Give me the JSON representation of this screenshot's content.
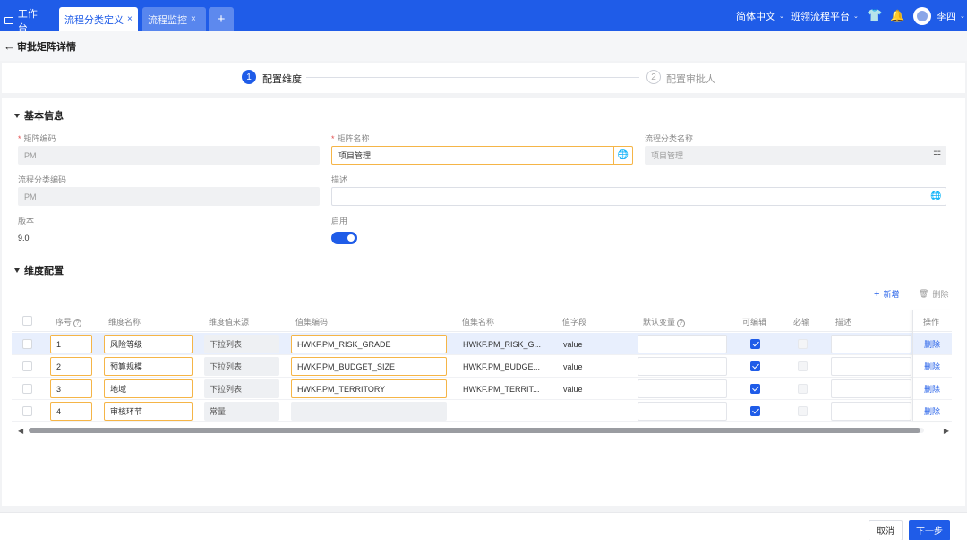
{
  "topbar": {
    "tabs": [
      {
        "label": "工作台"
      },
      {
        "label": "流程分类定义",
        "close": "×"
      },
      {
        "label": "流程监控",
        "close": "×"
      },
      {
        "label": "+"
      }
    ],
    "language": "简体中文",
    "platform": "班翎流程平台",
    "user": "李四",
    "chevron": "⌄",
    "shirt_glyph": "👕",
    "bell_glyph": "🔔",
    "accent_color": "#1f5ce8"
  },
  "header": {
    "back_arrow": "←",
    "title": "审批矩阵详情"
  },
  "steps": [
    {
      "num": "1",
      "label": "配置维度"
    },
    {
      "num": "2",
      "label": "配置审批人"
    }
  ],
  "basic": {
    "title": "基本信息",
    "matrix_code": {
      "label": "矩阵编码",
      "value": "PM"
    },
    "matrix_name": {
      "label": "矩阵名称",
      "value": "项目管理"
    },
    "category_name": {
      "label": "流程分类名称",
      "value": "项目管理"
    },
    "category_code": {
      "label": "流程分类编码",
      "value": "PM"
    },
    "description": {
      "label": "描述",
      "value": ""
    },
    "version": {
      "label": "版本",
      "value": "9.0"
    },
    "enabled": {
      "label": "启用",
      "value": true
    },
    "required_mark": "*",
    "globe_icon": "🌐",
    "lookup_icon": "☷"
  },
  "dimension": {
    "title": "维度配置",
    "add_label": "新增",
    "delete_label": "删除",
    "add_glyph": "+",
    "trash_glyph": "🗑",
    "help_glyph": "?",
    "columns": [
      "序号",
      "维度名称",
      "维度值来源",
      "值集编码",
      "值集名称",
      "值字段",
      "默认变量",
      "可编辑",
      "必输",
      "描述",
      "操作"
    ],
    "rows": [
      {
        "seq": "1",
        "name": "风险等级",
        "source": "下拉列表",
        "code": "HWKF.PM_RISK_GRADE",
        "set_name": "HWKF.PM_RISK_G...",
        "field": "value",
        "editable": true,
        "required": false,
        "op": "删除"
      },
      {
        "seq": "2",
        "name": "预算规模",
        "source": "下拉列表",
        "code": "HWKF.PM_BUDGET_SIZE",
        "set_name": "HWKF.PM_BUDGE...",
        "field": "value",
        "editable": true,
        "required": false,
        "op": "删除"
      },
      {
        "seq": "3",
        "name": "地域",
        "source": "下拉列表",
        "code": "HWKF.PM_TERRITORY",
        "set_name": "HWKF.PM_TERRIT...",
        "field": "value",
        "editable": true,
        "required": false,
        "op": "删除"
      },
      {
        "seq": "4",
        "name": "审核环节",
        "source": "常量",
        "code": "",
        "set_name": "",
        "field": "",
        "editable": true,
        "required": false,
        "op": "删除"
      }
    ],
    "scroll_left": "◀",
    "scroll_right": "▶"
  },
  "footer": {
    "cancel": "取消",
    "next": "下一步"
  }
}
